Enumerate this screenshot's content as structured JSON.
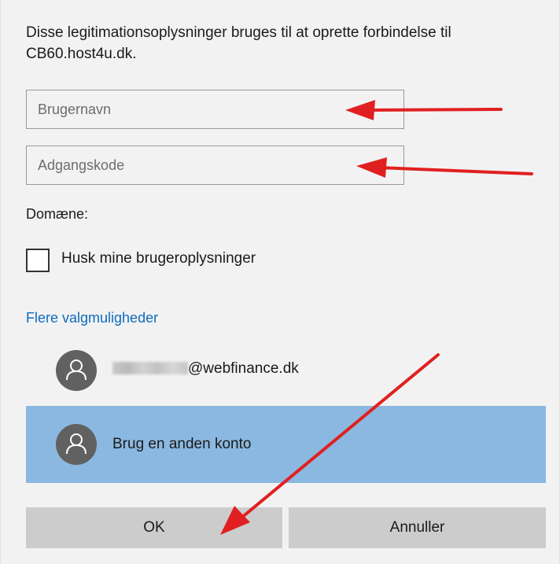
{
  "description": "Disse legitimationsoplysninger bruges til at oprette forbindelse til CB60.host4u.dk.",
  "username_field": {
    "placeholder": "Brugernavn",
    "value": ""
  },
  "password_field": {
    "placeholder": "Adgangskode",
    "value": ""
  },
  "domain_label": "Domæne:",
  "remember_checkbox": {
    "label": "Husk mine brugeroplysninger",
    "checked": false
  },
  "more_options_link": "Flere valgmuligheder",
  "accounts": [
    {
      "email_suffix": "@webfinance.dk",
      "icon": "person-icon",
      "selected": false
    },
    {
      "label": "Brug en anden konto",
      "icon": "person-icon",
      "selected": true
    }
  ],
  "buttons": {
    "ok": "OK",
    "cancel": "Annuller"
  },
  "colors": {
    "background": "#f2f2f2",
    "link": "#0f6cbd",
    "selected_account": "#8bb8e0",
    "button": "#cccccc",
    "annotation_arrow": "#e02020"
  }
}
